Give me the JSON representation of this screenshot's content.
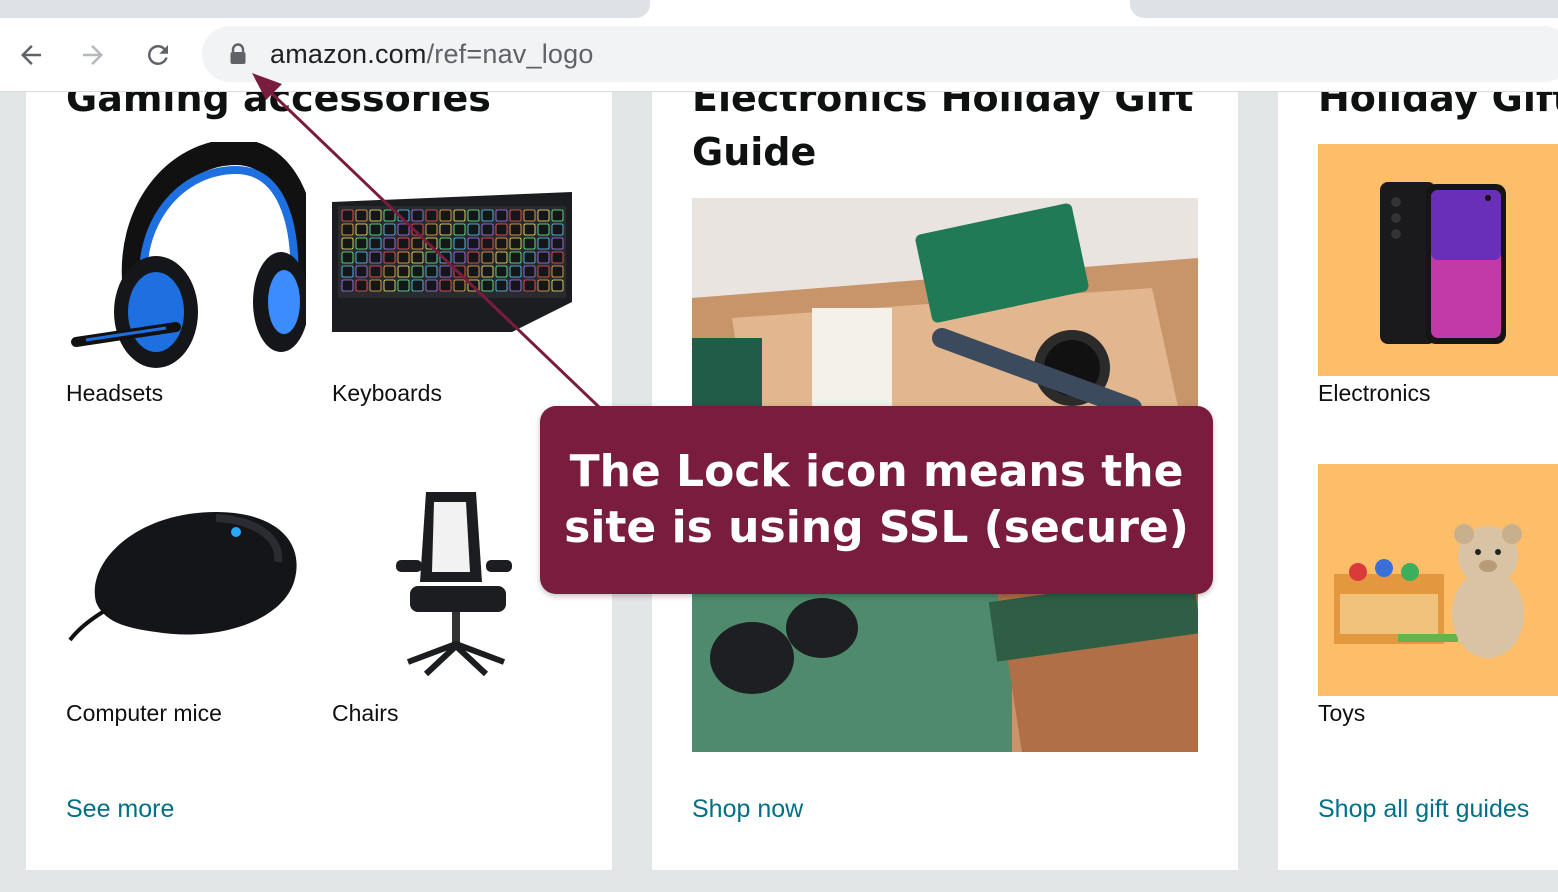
{
  "browser": {
    "url_host": "amazon.com",
    "url_path": "/ref=nav_logo"
  },
  "cards": {
    "gaming": {
      "title": "Gaming accessories",
      "tiles": [
        "Headsets",
        "Keyboards",
        "Computer mice",
        "Chairs"
      ],
      "cta": "See more"
    },
    "electronics": {
      "title": "Electronics Holiday Gift Guide",
      "cta": "Shop now"
    },
    "holiday": {
      "title": "Holiday Gift",
      "tiles": [
        "Electronics",
        "Toys"
      ],
      "cta": "Shop all gift guides"
    }
  },
  "annotation": {
    "text": "The Lock icon means the site is using SSL (secure)",
    "color": "#7a1c3e"
  },
  "colors": {
    "link": "#007185",
    "tile_background": "#febd69",
    "headset_blue": "#1e6fe0"
  }
}
